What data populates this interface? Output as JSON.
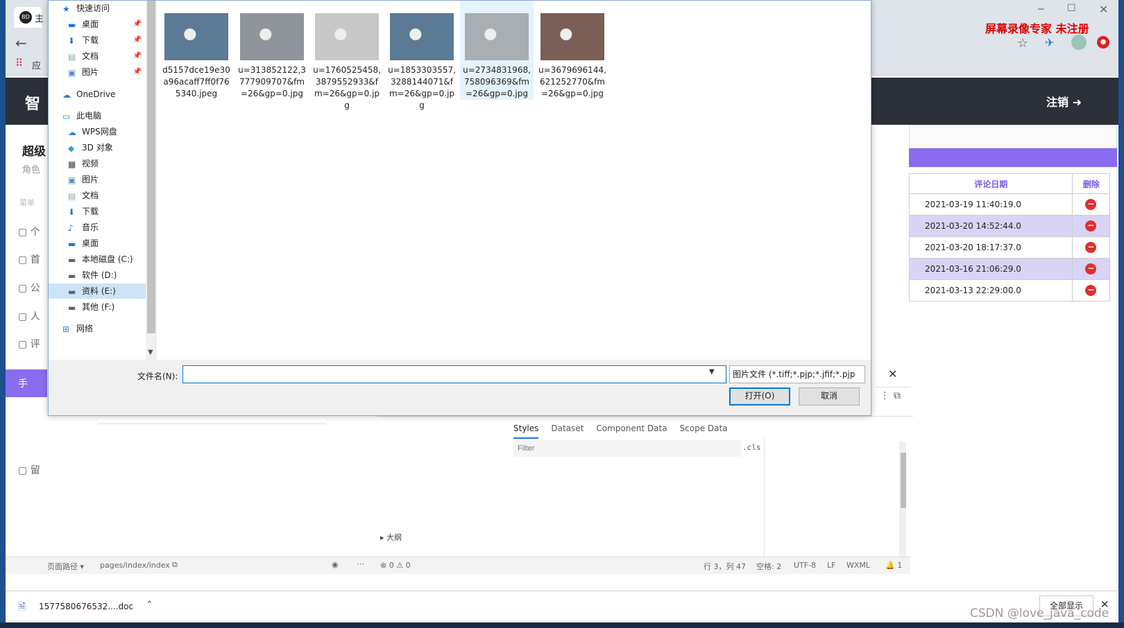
{
  "browser": {
    "tab_logo": "BD",
    "tab_title": "主",
    "apps_label": "应",
    "watermark": "屏幕录像专家 未注册",
    "minimize": "─",
    "maximize": "☐",
    "close": "✕"
  },
  "app": {
    "header_title": "智",
    "logout_label": "注销 ➜",
    "left_items": [
      "超级",
      "角色",
      "菜单",
      "个",
      "首",
      "公",
      "人",
      "评",
      "手",
      "留"
    ]
  },
  "comments_table": {
    "headers": [
      "评论日期",
      "删除"
    ],
    "rows": [
      {
        "date": "2021-03-19 11:40:19.0"
      },
      {
        "date": "2021-03-20 14:52:44.0"
      },
      {
        "date": "2021-03-20 18:17:37.0"
      },
      {
        "date": "2021-03-16 21:06:29.0"
      },
      {
        "date": "2021-03-13 22:29:00.0"
      }
    ]
  },
  "devtools": {
    "tabs": [
      "Styles",
      "Dataset",
      "Component Data",
      "Scope Data"
    ],
    "filter_placeholder": "Filter",
    "cls_label": ".cls",
    "outline_label": "大纲"
  },
  "statusbar": {
    "page_path_label": "页面路径 ▾",
    "page_path": "pages/index/index",
    "errors": "⊗ 0 ⚠ 0",
    "position": "行 3，列 47",
    "spaces": "空格: 2",
    "encoding": "UTF-8",
    "eol": "LF",
    "language": "WXML",
    "bell": "🔔 1"
  },
  "download": {
    "filename": "1577580676532....doc",
    "show_all": "全部显示"
  },
  "csdn_watermark": "CSDN @love_java_code",
  "dialog": {
    "nav_items": [
      {
        "label": "快速访问",
        "icon": "star-icon",
        "pin": false,
        "indent": 0
      },
      {
        "label": "桌面",
        "icon": "desktop-icon",
        "pin": true,
        "indent": 1
      },
      {
        "label": "下载",
        "icon": "download-icon",
        "pin": true,
        "indent": 1
      },
      {
        "label": "文档",
        "icon": "document-icon",
        "pin": true,
        "indent": 1
      },
      {
        "label": "图片",
        "icon": "picture-icon",
        "pin": true,
        "indent": 1
      },
      {
        "label": "OneDrive",
        "icon": "cloud-icon",
        "pin": false,
        "indent": 0
      },
      {
        "label": "此电脑",
        "icon": "computer-icon",
        "pin": false,
        "indent": 0
      },
      {
        "label": "WPS网盘",
        "icon": "cloud-icon",
        "pin": false,
        "indent": 1
      },
      {
        "label": "3D 对象",
        "icon": "cube-icon",
        "pin": false,
        "indent": 1
      },
      {
        "label": "视频",
        "icon": "video-icon",
        "pin": false,
        "indent": 1
      },
      {
        "label": "图片",
        "icon": "picture-icon",
        "pin": false,
        "indent": 1
      },
      {
        "label": "文档",
        "icon": "document-icon",
        "pin": false,
        "indent": 1
      },
      {
        "label": "下载",
        "icon": "download-icon",
        "pin": false,
        "indent": 1
      },
      {
        "label": "音乐",
        "icon": "music-icon",
        "pin": false,
        "indent": 1
      },
      {
        "label": "桌面",
        "icon": "desktop-icon",
        "pin": false,
        "indent": 1
      },
      {
        "label": "本地磁盘 (C:)",
        "icon": "drive-icon",
        "pin": false,
        "indent": 1
      },
      {
        "label": "软件 (D:)",
        "icon": "drive-icon",
        "pin": false,
        "indent": 1
      },
      {
        "label": "资料 (E:)",
        "icon": "drive-icon",
        "pin": false,
        "indent": 1,
        "selected": true
      },
      {
        "label": "其他 (F:)",
        "icon": "drive-icon",
        "pin": false,
        "indent": 1
      },
      {
        "label": "网络",
        "icon": "network-icon",
        "pin": false,
        "indent": 0
      }
    ],
    "files": [
      {
        "name": "d5157dce19e30a96acaff7ff0f765340.jpeg",
        "color": "#5a7a96"
      },
      {
        "name": "u=313852122,3777909707&fm=26&gp=0.jpg",
        "color": "#8f959a"
      },
      {
        "name": "u=1760525458,3879552933&fm=26&gp=0.jpg",
        "color": "#c8c8c8"
      },
      {
        "name": "u=1853303557,3288144071&fm=26&gp=0.jpg",
        "color": "#5a7a96"
      },
      {
        "name": "u=2734831968,758096369&fm=26&gp=0.jpg",
        "color": "#a8aeb2",
        "hover": true
      },
      {
        "name": "u=3679696144,621252770&fm=26&gp=0.jpg",
        "color": "#7b5e56"
      }
    ],
    "filename_label": "文件名(N):",
    "filename_value": "",
    "filter_value": "图片文件 (*.tiff;*.pjp;*.jfif;*.pjp",
    "open_label": "打开(O)",
    "cancel_label": "取消"
  }
}
